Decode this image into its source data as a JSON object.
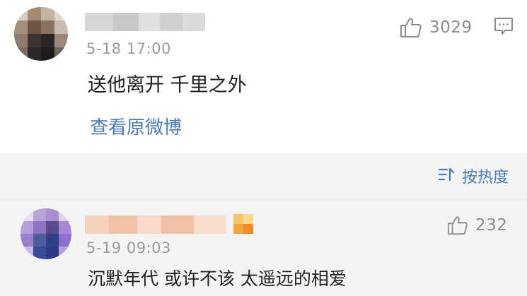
{
  "post": {
    "author_name_blurred": true,
    "time": "5-18 17:00",
    "like_count": "3029",
    "text": "送他离开 千里之外",
    "view_original_label": "查看原微博",
    "like_icon": "thumbs-up-icon",
    "comment_icon": "comment-icon"
  },
  "sort": {
    "label": "按热度",
    "icon": "sort-icon"
  },
  "comment": {
    "author_name_blurred": true,
    "time": "5-19 09:03",
    "like_count": "232",
    "text": "沉默年代 或许不该 太遥远的相爱",
    "like_icon": "thumbs-up-icon",
    "badge_icon": "member-badge-icon"
  },
  "colors": {
    "link": "#4a7ab8",
    "time": "#9a9a9a",
    "meta": "#8c8c8c",
    "section_bg": "#f4f4f4"
  }
}
